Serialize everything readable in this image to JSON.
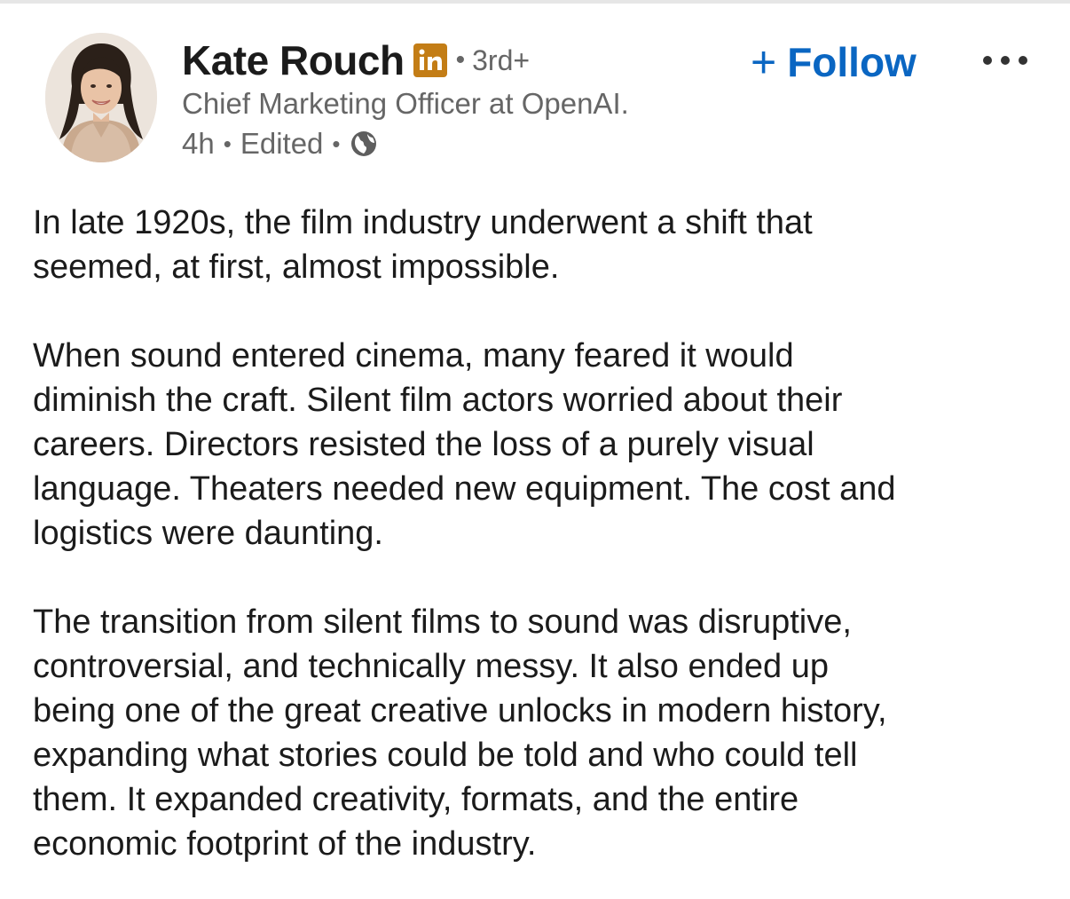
{
  "author": {
    "name": "Kate Rouch",
    "badge_icon": "linkedin-premium-icon",
    "separator": "•",
    "connection_degree": "3rd+",
    "headline": "Chief Marketing Officer at OpenAI.",
    "time_ago": "4h",
    "edited_label": "Edited",
    "visibility_icon": "globe-icon"
  },
  "actions": {
    "follow_label": "Follow",
    "follow_icon": "plus-icon",
    "more_icon": "more-icon"
  },
  "colors": {
    "accent": "#0a66c2",
    "badge": "#c37d16",
    "secondary_text": "#666666",
    "primary_text": "#1b1b1b"
  },
  "post": {
    "paragraphs": [
      "In late 1920s, the film industry underwent a shift that\nseemed, at first, almost impossible.",
      "When sound entered cinema, many feared it would\ndiminish the craft. Silent film actors worried about their\ncareers. Directors resisted the loss of a purely visual\nlanguage. Theaters needed new equipment. The cost and\nlogistics were daunting.",
      "The transition from silent films to sound was disruptive,\ncontroversial, and technically messy. It also ended up\nbeing one of the great creative unlocks in modern history,\nexpanding what stories could be told and who could tell\nthem. It expanded creativity, formats, and the entire\neconomic footprint of the industry."
    ]
  }
}
